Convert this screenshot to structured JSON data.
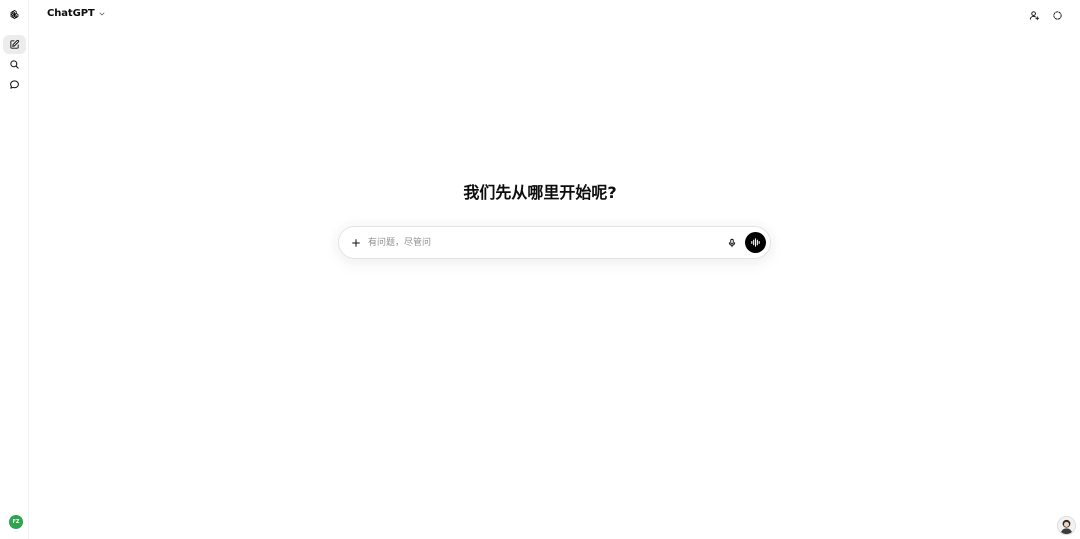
{
  "header": {
    "model_name": "ChatGPT"
  },
  "sidebar": {
    "items": [
      {
        "name": "new-chat",
        "icon": "edit-icon"
      },
      {
        "name": "search",
        "icon": "search-icon"
      },
      {
        "name": "chats",
        "icon": "chat-bubble-icon"
      }
    ],
    "user_initials": "FZ"
  },
  "main": {
    "headline": "我们先从哪里开始呢?",
    "composer": {
      "placeholder": "有问题，尽管问"
    }
  },
  "colors": {
    "accent": "#0d0d0d",
    "avatar_bg": "#2ea44f",
    "voice_button_bg": "#000000"
  }
}
